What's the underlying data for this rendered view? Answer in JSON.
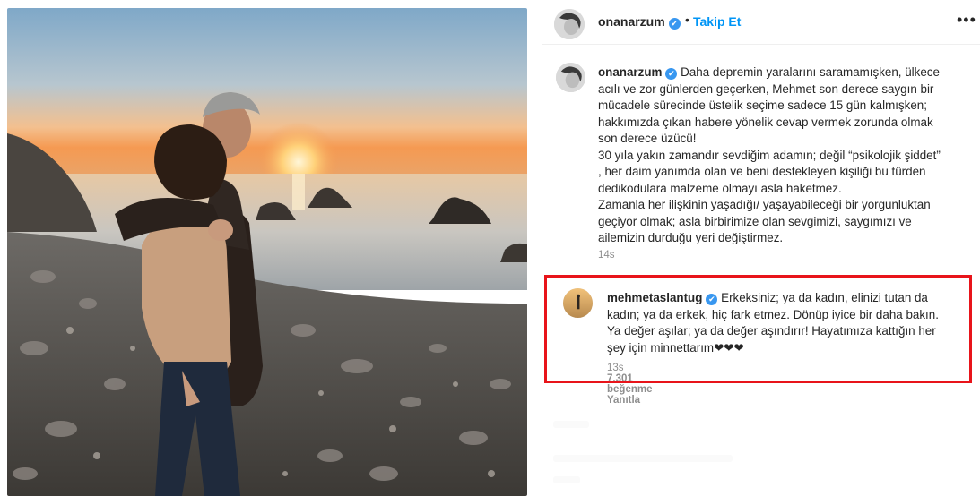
{
  "post": {
    "username": "onanarzum",
    "follow_label": "Takip Et",
    "separator": "•",
    "more_label": "•••",
    "verified_mark": "✔"
  },
  "caption": {
    "username": "onanarzum",
    "lines": [
      "Daha depremin yaralarını saramamışken, ülkece",
      "acılı ve zor günlerden geçerken, Mehmet son derece saygın bir",
      "mücadele sürecinde üstelik seçime sadece 15 gün kalmışken;",
      "hakkımızda çıkan habere yönelik cevap vermek zorunda olmak",
      "son derece üzücü!",
      "30 yıla yakın zamandır sevdiğim adamın; değil “psikolojik şiddet”",
      ", her daim yanımda olan ve beni destekleyen kişiliği bu türden",
      "dedikodulara malzeme olmayı asla haketmez.",
      "Zamanla her ilişkinin yaşadığı/ yaşayabileceği bir yorgunluktan",
      "geçiyor olmak; asla birbirimize olan sevgimizi, saygımızı ve",
      "ailemizin durduğu yeri değiştirmez."
    ],
    "time": "14s"
  },
  "reply": {
    "username": "mehmetaslantug",
    "lines": [
      "Erkeksiniz; ya da kadın, elinizi tutan da",
      "kadın; ya da erkek, hiç fark etmez. Dönüp iyice bir daha bakın.",
      "Ya değer aşılar; ya da değer aşındırır! Hayatımıza kattığın her",
      "şey için minnettarım❤❤❤"
    ],
    "time": "13s",
    "likes": "7.301 beğenme",
    "reply_label": "Yanıtla"
  },
  "colors": {
    "accent": "#0095f6",
    "verified": "#3897f0",
    "highlight": "#e8141a",
    "muted": "#8e8e8e"
  }
}
